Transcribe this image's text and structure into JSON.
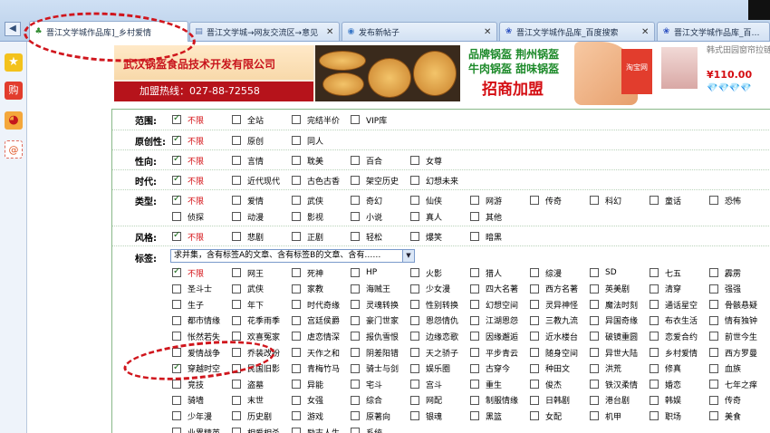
{
  "tabs": [
    {
      "label": "晋江文学城作品库]_乡村爱情",
      "icon": "tree-icon",
      "active": true
    },
    {
      "label": "晋江文学城→网友交流区→意见",
      "icon": "page-icon",
      "active": false
    },
    {
      "label": "发布新帖子",
      "icon": "globe-icon",
      "active": false
    },
    {
      "label": "晋江文学城作品库_百度搜索",
      "icon": "baidu-paw-icon",
      "active": false
    },
    {
      "label": "晋江文学城作品库_百度搜索",
      "icon": "baidu-paw-icon",
      "active": false
    }
  ],
  "ads": {
    "company": "武汉锅盔食品技术开发有限公司",
    "hotline": "加盟热线：027-88-72558",
    "slogan1": "品牌锅盔 荆州锅盔",
    "slogan2": "牛肉锅盔 甜味锅盔",
    "slogan3": "招商加盟",
    "taobao": "淘宝网",
    "product_text": "韩式田园窗帘拉链成品卷帘遮光柔纱",
    "price": "¥110.00",
    "diamonds": "💎💎💎💎"
  },
  "filters": {
    "scope": {
      "label": "范围:",
      "options": [
        "不限",
        "全站",
        "完结半价",
        "VIP库"
      ]
    },
    "originality": {
      "label": "原创性:",
      "options": [
        "不限",
        "原创",
        "同人"
      ]
    },
    "orientation": {
      "label": "性向:",
      "options": [
        "不限",
        "言情",
        "耽美",
        "百合",
        "女尊"
      ]
    },
    "era": {
      "label": "时代:",
      "options": [
        "不限",
        "近代现代",
        "古色古香",
        "架空历史",
        "幻想未来"
      ]
    },
    "genre": {
      "label": "类型:",
      "options": [
        "不限",
        "爱情",
        "武侠",
        "奇幻",
        "仙侠",
        "网游",
        "传奇",
        "科幻",
        "童话",
        "恐怖",
        "侦探",
        "动漫",
        "影视",
        "小说",
        "真人",
        "其他"
      ]
    },
    "style": {
      "label": "风格:",
      "options": [
        "不限",
        "悲剧",
        "正剧",
        "轻松",
        "爆笑",
        "暗黑"
      ]
    },
    "tags": {
      "label": "标签:",
      "select_value": "求并集，含有标签A的文章、含有标签B的文章、含有……",
      "options": [
        "不限",
        "网王",
        "死神",
        "HP",
        "火影",
        "猎人",
        "综漫",
        "SD",
        "七五",
        "霹雳",
        "圣斗士",
        "武侠",
        "家教",
        "海贼王",
        "少女漫",
        "四大名著",
        "西方名著",
        "英美剧",
        "清穿",
        "强强",
        "生子",
        "年下",
        "时代奇缘",
        "灵魂转换",
        "性别转换",
        "幻想空间",
        "灵异神怪",
        "魔法时刻",
        "通话星空",
        "骨骸悬疑",
        "都市情缘",
        "花季雨季",
        "宫廷侯爵",
        "豪门世家",
        "恩怨情仇",
        "江湖恩怨",
        "三教九流",
        "异国奇缘",
        "布衣生活",
        "情有独钟",
        "怅然若失",
        "欢喜冤家",
        "虐恋情深",
        "报仇雪恨",
        "边缘恋歌",
        "因缘邂逅",
        "近水楼台",
        "破镜重圆",
        "恋爱合约",
        "前世今生",
        "爱情战争",
        "乔装改扮",
        "天作之和",
        "阴差阳错",
        "天之骄子",
        "平步青云",
        "随身空间",
        "异世大陆",
        "乡村爱情",
        "西方罗曼",
        "穿越时空",
        "民国旧影",
        "青梅竹马",
        "骑士与剑",
        "娱乐圈",
        "古穿今",
        "种田文",
        "洪荒",
        "修真",
        "血族",
        "竞技",
        "盗墓",
        "异能",
        "宅斗",
        "宫斗",
        "重生",
        "俊杰",
        "铁汉柔情",
        "婚恋",
        "七年之痒",
        "骑墙",
        "末世",
        "女强",
        "综合",
        "网配",
        "制服情缘",
        "日韩剧",
        "港台剧",
        "韩娱",
        "传奇",
        "少年漫",
        "历史剧",
        "游戏",
        "原著向",
        "银魂",
        "黑篮",
        "女配",
        "机甲",
        "职场",
        "美食",
        "业界精英",
        "相爱相杀",
        "励志人生",
        "系统"
      ],
      "checked": [
        "不限",
        "穿越时空"
      ]
    }
  }
}
